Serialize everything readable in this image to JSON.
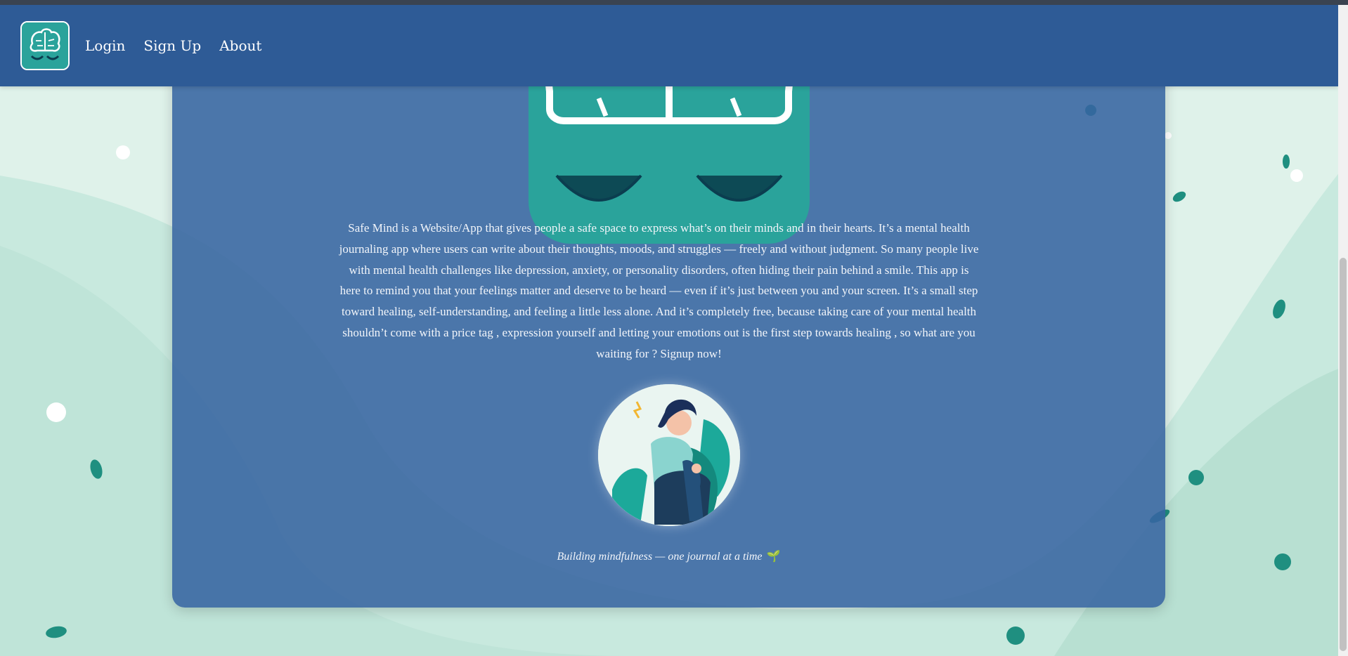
{
  "nav": {
    "logo_icon": "brain-logo-icon",
    "links": [
      {
        "label": "Login"
      },
      {
        "label": "Sign Up"
      },
      {
        "label": "About"
      }
    ]
  },
  "main": {
    "description": "Safe Mind is a Website/App that gives people a safe space to express what’s on their minds and in their hearts. It’s a mental health journaling app where users can write about their thoughts, moods, and struggles — freely and without judgment. So many people live with mental health challenges like depression, anxiety, or personality disorders, often hiding their pain behind a smile. This app is here to remind you that your feelings matter and deserve to be heard — even if it’s just between you and your screen. It’s a small step toward healing, self-understanding, and feeling a little less alone. And it’s completely free, because taking care of your mental health shouldn’t come with a price tag , expression yourself and letting your emotions out is the first step towards healing , so what are you waiting for ? Signup now!",
    "tagline": "Building mindfulness — one journal at a time",
    "tagline_emoji": "🌱",
    "illustration": "woman-sitting-illustration"
  },
  "colors": {
    "navbar": "#2e5b96",
    "card": "#3764a0",
    "background": "#dff2ea",
    "logo_teal": "#2aa39b",
    "text": "#f2f5fa"
  }
}
